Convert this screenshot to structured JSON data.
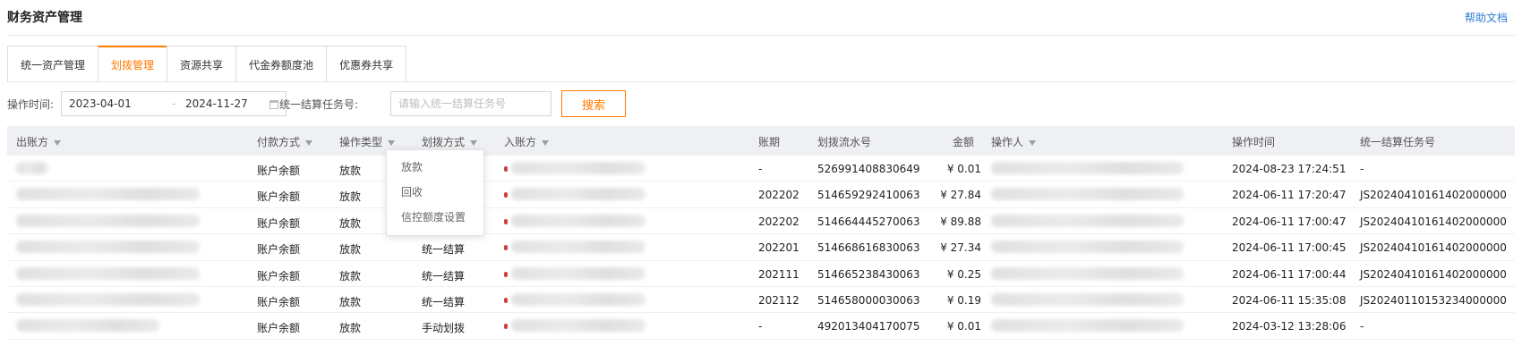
{
  "header": {
    "title": "财务资产管理",
    "help": "帮助文档"
  },
  "tabs": [
    {
      "label": "统一资产管理",
      "active": false
    },
    {
      "label": "划拨管理",
      "active": true
    },
    {
      "label": "资源共享",
      "active": false
    },
    {
      "label": "代金券额度池",
      "active": false
    },
    {
      "label": "优惠券共享",
      "active": false
    }
  ],
  "filters": {
    "time_label": "操作时间:",
    "start_date": "2023-04-01",
    "end_date": "2024-11-27",
    "task_label": "统一结算任务号:",
    "task_placeholder": "请输入统一结算任务号",
    "search_label": "搜索"
  },
  "table": {
    "headers": {
      "out_account": "出账方",
      "pay_method": "付款方式",
      "op_type": "操作类型",
      "transfer_method": "划拨方式",
      "in_account": "入账方",
      "period": "账期",
      "serial": "划拨流水号",
      "amount": "金额",
      "operator": "操作人",
      "op_time": "操作时间",
      "task_no": "统一结算任务号"
    },
    "rows": [
      {
        "pay_method": "账户余额",
        "op_type": "放款",
        "transfer_method": "",
        "period": "-",
        "serial": "526991408830649",
        "amount": "¥ 0.01",
        "op_time": "2024-08-23 17:24:51",
        "task_no": "-"
      },
      {
        "pay_method": "账户余额",
        "op_type": "放款",
        "transfer_method": "",
        "period": "202202",
        "serial": "514659292410063",
        "amount": "¥ 27.84",
        "op_time": "2024-06-11 17:20:47",
        "task_no": "JS20240410161402000000"
      },
      {
        "pay_method": "账户余额",
        "op_type": "放款",
        "transfer_method": "",
        "period": "202202",
        "serial": "514664445270063",
        "amount": "¥ 89.88",
        "op_time": "2024-06-11 17:00:47",
        "task_no": "JS20240410161402000000"
      },
      {
        "pay_method": "账户余额",
        "op_type": "放款",
        "transfer_method": "统一结算",
        "period": "202201",
        "serial": "514668616830063",
        "amount": "¥ 27.34",
        "op_time": "2024-06-11 17:00:45",
        "task_no": "JS20240410161402000000"
      },
      {
        "pay_method": "账户余额",
        "op_type": "放款",
        "transfer_method": "统一结算",
        "period": "202111",
        "serial": "514665238430063",
        "amount": "¥ 0.25",
        "op_time": "2024-06-11 17:00:44",
        "task_no": "JS20240410161402000000"
      },
      {
        "pay_method": "账户余额",
        "op_type": "放款",
        "transfer_method": "统一结算",
        "period": "202112",
        "serial": "514658000030063",
        "amount": "¥ 0.19",
        "op_time": "2024-06-11 15:35:08",
        "task_no": "JS20240110153234000000"
      },
      {
        "pay_method": "账户余额",
        "op_type": "放款",
        "transfer_method": "手动划拨",
        "period": "-",
        "serial": "492013404170075",
        "amount": "¥ 0.01",
        "op_time": "2024-03-12 13:28:06",
        "task_no": "-"
      }
    ]
  },
  "dropdown": {
    "items": [
      "放款",
      "回收",
      "信控额度设置"
    ]
  }
}
